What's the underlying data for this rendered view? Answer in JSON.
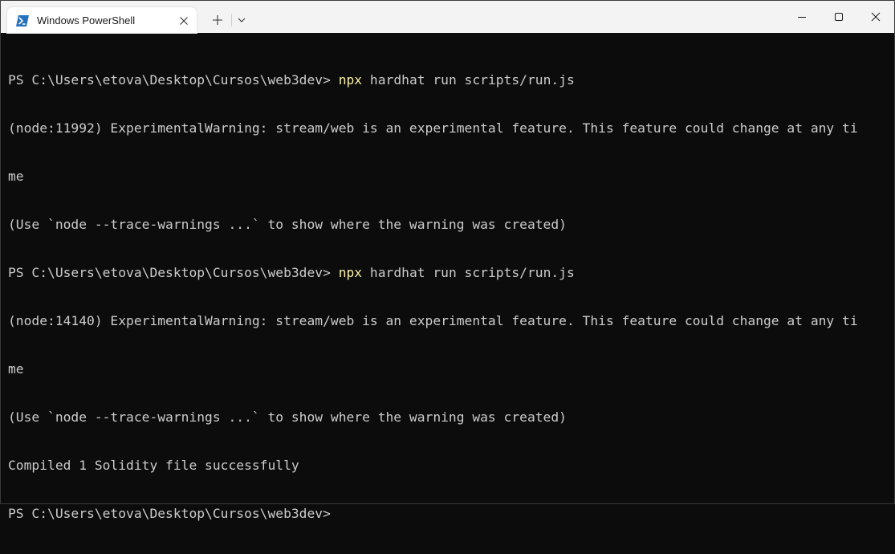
{
  "window": {
    "tab_title": "Windows PowerShell",
    "tab_icon": "powershell-icon",
    "tab_close_icon": "close-icon",
    "new_tab_icon": "plus-icon",
    "dropdown_icon": "chevron-down-icon",
    "minimize_icon": "minimize-icon",
    "maximize_icon": "maximize-icon",
    "close_icon": "close-icon"
  },
  "colors": {
    "terminal_bg": "#0c0c0c",
    "terminal_fg": "#cccccc",
    "command_highlight": "#f9f1a5",
    "titlebar_bg": "#f3f3f3",
    "powershell_icon": "#2671be"
  },
  "terminal": {
    "lines": [
      {
        "prompt": "PS C:\\Users\\etova\\Desktop\\Cursos\\web3dev> ",
        "cmd": "npx",
        "rest": " hardhat run scripts/run.js"
      },
      {
        "text": "(node:11992) ExperimentalWarning: stream/web is an experimental feature. This feature could change at any ti"
      },
      {
        "text": "me"
      },
      {
        "text": "(Use `node --trace-warnings ...` to show where the warning was created)"
      },
      {
        "prompt": "PS C:\\Users\\etova\\Desktop\\Cursos\\web3dev> ",
        "cmd": "npx",
        "rest": " hardhat run scripts/run.js"
      },
      {
        "text": "(node:14140) ExperimentalWarning: stream/web is an experimental feature. This feature could change at any ti"
      },
      {
        "text": "me"
      },
      {
        "text": "(Use `node --trace-warnings ...` to show where the warning was created)"
      },
      {
        "text": "Compiled 1 Solidity file successfully"
      },
      {
        "text": "PS C:\\Users\\etova\\Desktop\\Cursos\\web3dev>"
      }
    ]
  }
}
